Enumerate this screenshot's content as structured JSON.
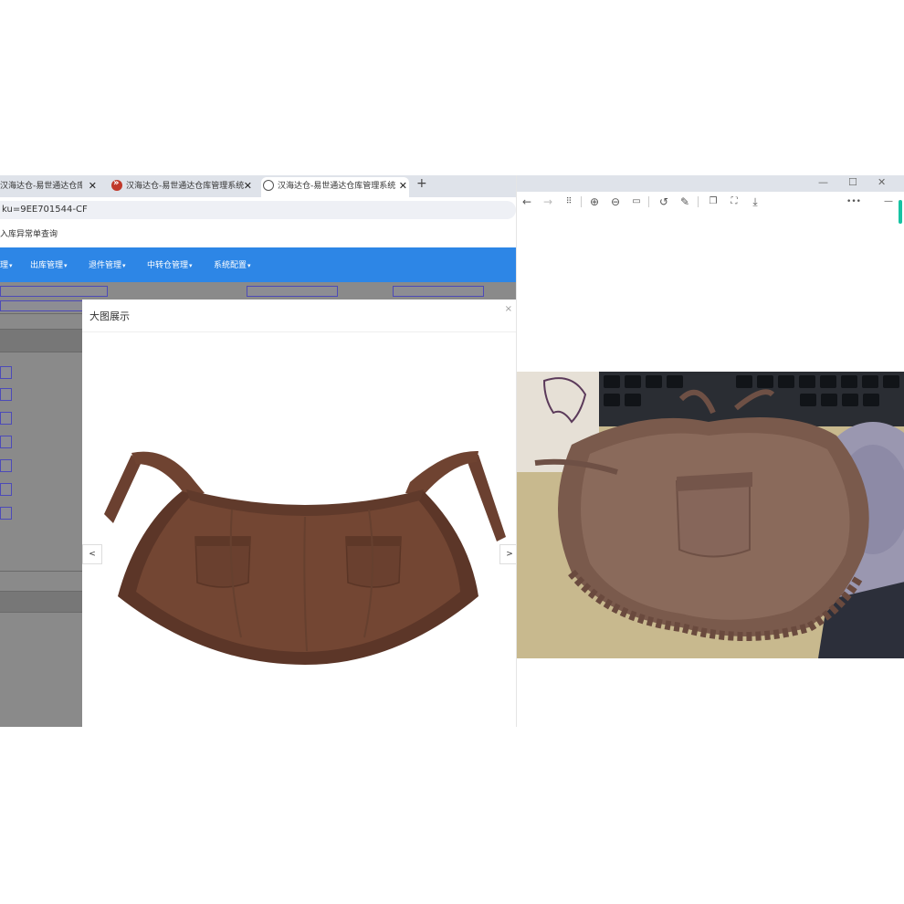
{
  "browser": {
    "tabs": [
      {
        "title": "汉海达仓-易世通达仓库管理系统"
      },
      {
        "title": "汉海达仓-易世通达仓库管理系统"
      },
      {
        "title": "汉海达仓-易世通达仓库管理系统"
      }
    ],
    "new_tab": "+",
    "close_glyph": "✕",
    "url": "ku=9EE701544-CF",
    "breadcrumb": "入库异常单查询"
  },
  "navbar": {
    "items": [
      "出库管理",
      "退件管理",
      "中转仓管理",
      "系统配置"
    ],
    "partial_item": "理"
  },
  "modal": {
    "title": "大图展示",
    "close": "×",
    "prev": "<",
    "next": ">"
  },
  "viewer": {
    "window_controls": {
      "minimize": "—",
      "maximize": "☐",
      "close": "✕"
    },
    "toolbar": [
      "back",
      "forward",
      "grid",
      "zoom-in",
      "zoom-out",
      "actual-size",
      "rotate",
      "edit",
      "copy",
      "fit-screen",
      "save",
      "more",
      "minimize-panel"
    ],
    "more": "•••",
    "panel_min": "—",
    "accent": "#16c3a3"
  },
  "colors": {
    "navbar": "#2d86e6",
    "apron": "#6f4331",
    "overlay": "#8a8a8a"
  }
}
